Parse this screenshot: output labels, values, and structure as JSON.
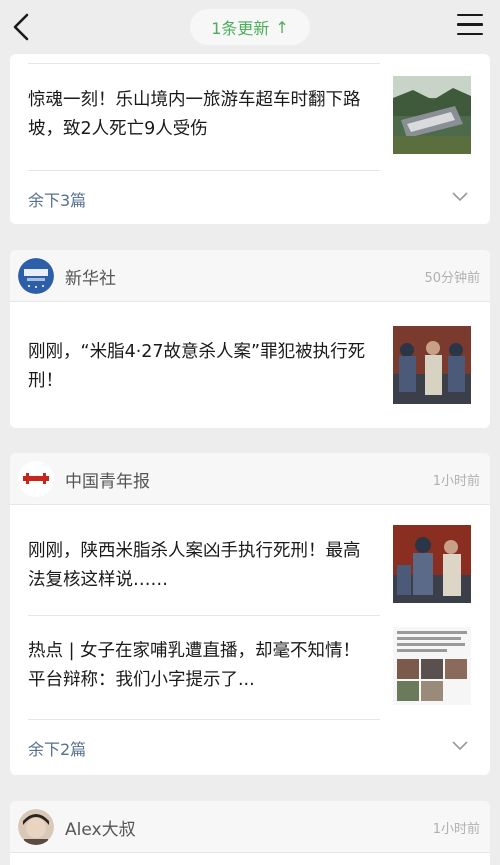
{
  "topbar": {
    "back_icon": "chevron-left-icon",
    "update_label": "1条更新",
    "update_arrow": "↑",
    "menu_icon": "hamburger-menu-icon"
  },
  "card1": {
    "article1": {
      "title": "惊魂一刻！乐山境内一旅游车超车时翻下路坡，致2人死亡9人受伤"
    },
    "more_label": "余下3篇"
  },
  "card2": {
    "source": "新华社",
    "time": "50分钟前",
    "article1": {
      "title": "刚刚，“米脂4·27故意杀人案”罪犯被执行死刑！"
    }
  },
  "card3": {
    "source": "中国青年报",
    "time": "1小时前",
    "article1": {
      "title": "刚刚，陕西米脂杀人案凶手执行死刑！最高法复核这样说……"
    },
    "article2": {
      "title": "热点 | 女子在家哺乳遭直播，却毫不知情！平台辩称：我们小字提示了..."
    },
    "more_label": "余下2篇"
  },
  "card4": {
    "source": "Alex大叔",
    "time": "1小时前"
  },
  "colors": {
    "accent_green": "#4cae5a",
    "link_blue": "#56708f",
    "background": "#ededed"
  }
}
